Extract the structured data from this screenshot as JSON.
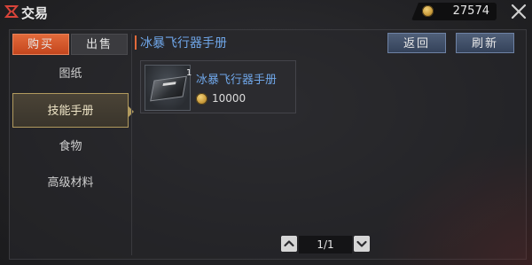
{
  "header": {
    "title": "交易"
  },
  "currency": {
    "icon": "gold-coin-icon",
    "amount": "27574"
  },
  "tabs": [
    {
      "label": "购买",
      "active": true
    },
    {
      "label": "出售",
      "active": false
    }
  ],
  "sidebar": {
    "items": [
      {
        "label": "图纸",
        "active": false
      },
      {
        "label": "技能手册",
        "active": true
      },
      {
        "label": "食物",
        "active": false
      },
      {
        "label": "高级材料",
        "active": false
      }
    ]
  },
  "content": {
    "title": "冰暴飞行器手册",
    "back_label": "返回",
    "refresh_label": "刷新"
  },
  "items": [
    {
      "name": "冰暴飞行器手册",
      "quantity": "1",
      "price": "10000",
      "price_icon": "gold-coin-icon"
    }
  ],
  "pager": {
    "text": "1/1"
  },
  "colors": {
    "accent_orange": "#e26a3a",
    "link_blue": "#6fa6e8",
    "button_blue": "#4f5f78",
    "gold": "#b19a5e"
  }
}
